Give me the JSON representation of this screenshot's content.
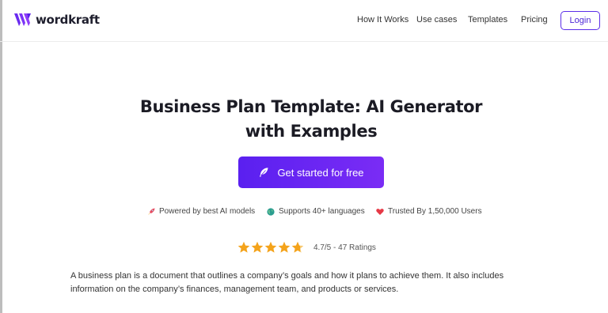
{
  "brand": {
    "name": "wordkraft",
    "accent": "#5b2ee8"
  },
  "nav": {
    "items": [
      "How It Works",
      "Use cases",
      "Templates",
      "Pricing"
    ],
    "login_label": "Login"
  },
  "hero": {
    "title_line1": "Business Plan Template: AI Generator",
    "title_line2": "with Examples",
    "cta_label": "Get started for free",
    "cta_icon": "feather-icon"
  },
  "features": [
    {
      "icon": "rocket-icon",
      "label": "Powered by best AI models"
    },
    {
      "icon": "globe-icon",
      "label": "Supports 40+ languages"
    },
    {
      "icon": "heart-icon",
      "label": "Trusted By 1,50,000 Users"
    }
  ],
  "rating": {
    "score": 4.7,
    "max": 5,
    "label": "4.7/5 - 47 Ratings",
    "star_color": "#f4a31b"
  },
  "description": {
    "line1": "A business plan is a document that outlines a company’s goals and how it plans to achieve them. It also includes",
    "line2": "information on the company’s finances, management team, and products or services."
  }
}
